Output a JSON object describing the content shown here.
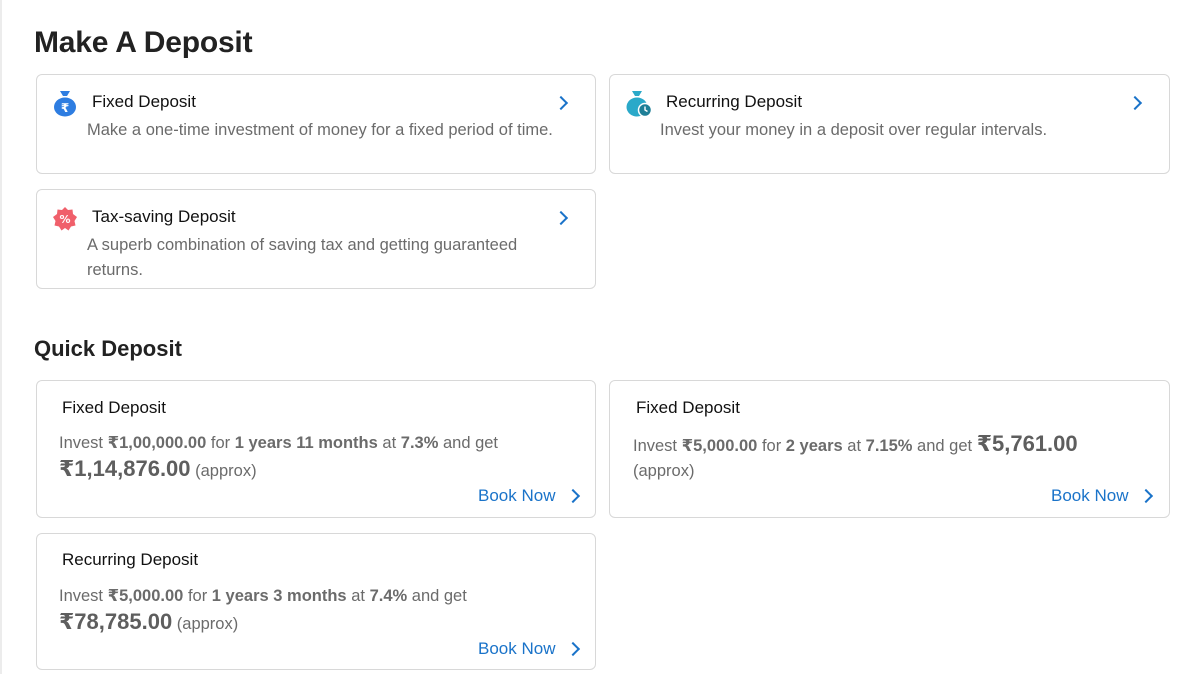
{
  "make_deposit": {
    "title": "Make A Deposit",
    "options": [
      {
        "title": "Fixed Deposit",
        "description": "Make a one-time investment of money for a fixed period of time.",
        "icon": "rupee-moneybag-icon"
      },
      {
        "title": "Recurring Deposit",
        "description": "Invest your money in a deposit over regular intervals.",
        "icon": "moneybag-clock-icon"
      },
      {
        "title": "Tax-saving Deposit",
        "description": "A superb combination of saving tax and getting guaranteed returns.",
        "icon": "percent-badge-icon"
      }
    ]
  },
  "quick_deposit": {
    "title": "Quick Deposit",
    "book_label": "Book Now",
    "cards": [
      {
        "title": "Fixed Deposit",
        "invest": "Invest",
        "amount": "₹1,00,000.00",
        "for": "for",
        "tenure": "1 years 11 months",
        "at": "at",
        "rate": "7.3%",
        "and_get": "and get",
        "maturity": "₹1,14,876.00",
        "approx": "(approx)"
      },
      {
        "title": "Fixed Deposit",
        "invest": "Invest",
        "amount": "₹5,000.00",
        "for": "for",
        "tenure": "2 years",
        "at": "at",
        "rate": "7.15%",
        "and_get": "and get",
        "maturity": "₹5,761.00",
        "approx": "(approx)"
      },
      {
        "title": "Recurring Deposit",
        "invest": "Invest",
        "amount": "₹5,000.00",
        "for": "for",
        "tenure": "1 years 3 months",
        "at": "at",
        "rate": "7.4%",
        "and_get": "and get",
        "maturity": "₹78,785.00",
        "approx": "(approx)"
      }
    ]
  },
  "colors": {
    "link": "#1a73c9",
    "border": "#d8d8d8",
    "muted_text": "#6b6b6b",
    "fd_icon": "#2e7de1",
    "rd_icon": "#2aa9c9",
    "tax_icon": "#f0606b"
  }
}
